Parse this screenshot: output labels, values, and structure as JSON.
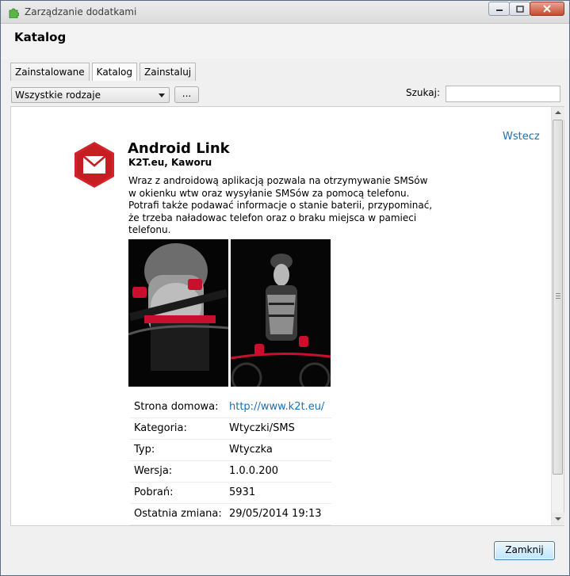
{
  "window": {
    "title": "Zarządzanie dodatkami"
  },
  "header": {
    "title": "Katalog"
  },
  "tabs": [
    {
      "label": "Zainstalowane"
    },
    {
      "label": "Katalog"
    },
    {
      "label": "Zainstaluj"
    }
  ],
  "toolbar": {
    "type_filter_value": "Wszystkie rodzaje",
    "more_label": "...",
    "search_label": "Szukaj:",
    "search_value": ""
  },
  "addon": {
    "back_label": "Wstecz",
    "name": "Android Link",
    "author": "K2T.eu, Kaworu",
    "description": "Wraz z androidową aplikacją pozwala na otrzymywanie SMSów w okienku wtw oraz wysyłanie SMSów za pomocą telefonu. Potrafi także podawać informacje o stanie baterii, przypominać, że trzeba naładowac telefon oraz o braku miejsca w pamieci telefonu.",
    "icon": "envelope-icon",
    "accent_color": "#d42329",
    "details": [
      {
        "key": "Strona domowa:",
        "value": "http://www.k2t.eu/"
      },
      {
        "key": "Kategoria:",
        "value": "Wtyczki/SMS"
      },
      {
        "key": "Typ:",
        "value": "Wtyczka"
      },
      {
        "key": "Wersja:",
        "value": "1.0.0.200"
      },
      {
        "key": "Pobrań:",
        "value": "5931"
      },
      {
        "key": "Ostatnia zmiana:",
        "value": "29/05/2014 19:13"
      }
    ]
  },
  "footer": {
    "close_label": "Zamknij"
  }
}
